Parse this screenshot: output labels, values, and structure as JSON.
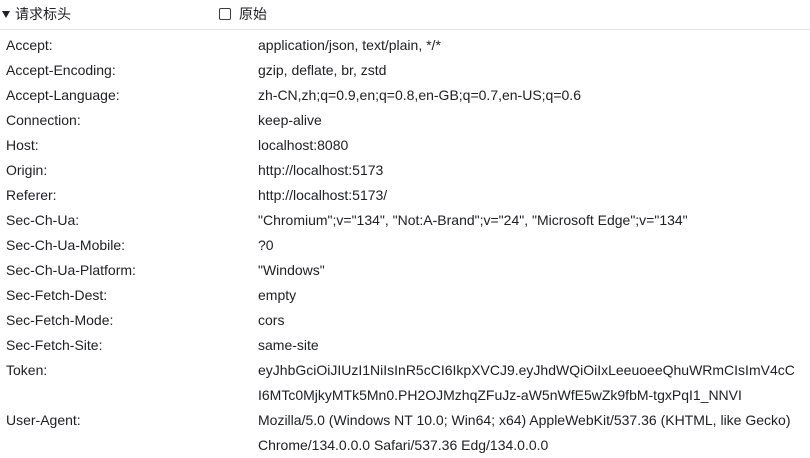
{
  "section": {
    "title": "请求标头",
    "raw_label": "原始"
  },
  "headers": [
    {
      "name": "Accept:",
      "value": "application/json, text/plain, */*"
    },
    {
      "name": "Accept-Encoding:",
      "value": "gzip, deflate, br, zstd"
    },
    {
      "name": "Accept-Language:",
      "value": "zh-CN,zh;q=0.9,en;q=0.8,en-GB;q=0.7,en-US;q=0.6"
    },
    {
      "name": "Connection:",
      "value": "keep-alive"
    },
    {
      "name": "Host:",
      "value": "localhost:8080"
    },
    {
      "name": "Origin:",
      "value": "http://localhost:5173"
    },
    {
      "name": "Referer:",
      "value": "http://localhost:5173/"
    },
    {
      "name": "Sec-Ch-Ua:",
      "value": "\"Chromium\";v=\"134\", \"Not:A-Brand\";v=\"24\", \"Microsoft Edge\";v=\"134\""
    },
    {
      "name": "Sec-Ch-Ua-Mobile:",
      "value": "?0"
    },
    {
      "name": "Sec-Ch-Ua-Platform:",
      "value": "\"Windows\""
    },
    {
      "name": "Sec-Fetch-Dest:",
      "value": "empty"
    },
    {
      "name": "Sec-Fetch-Mode:",
      "value": "cors"
    },
    {
      "name": "Sec-Fetch-Site:",
      "value": "same-site"
    },
    {
      "name": "Token:",
      "value": "eyJhbGciOiJIUzI1NiIsInR5cCI6IkpXVCJ9.eyJhdWQiOiIxLeeuoeeQhuWRmCIsImV4cCI6MTc0MjkyMTk5Mn0.PH2OJMzhqZFuJz-aW5nWfE5wZk9fbM-tgxPqI1_NNVI"
    },
    {
      "name": "User-Agent:",
      "value": "Mozilla/5.0 (Windows NT 10.0; Win64; x64) AppleWebKit/537.36 (KHTML, like Gecko) Chrome/134.0.0.0 Safari/537.36 Edg/134.0.0.0"
    }
  ]
}
